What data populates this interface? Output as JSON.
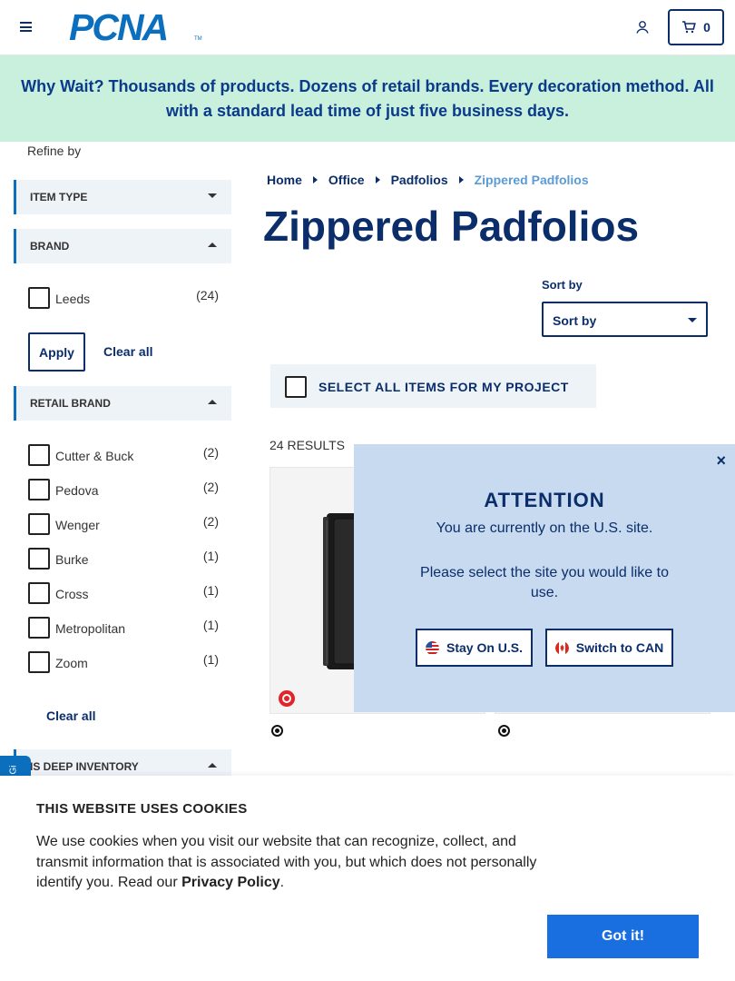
{
  "header": {
    "logo_text": "PCNA",
    "logo_tm": "TM",
    "cart_count": "0"
  },
  "banner": {
    "text": "Why Wait? Thousands of products. Dozens of retail brands. Every decoration method. All with a standard lead time of just five business days."
  },
  "sidebar": {
    "refine_by": "Refine by",
    "facets": {
      "item_type": {
        "label": "ITEM TYPE"
      },
      "brand": {
        "label": "BRAND",
        "options": [
          {
            "label": "Leeds",
            "count": "(24)"
          }
        ],
        "apply_label": "Apply",
        "clear_label": "Clear all"
      },
      "retail_brand": {
        "label": "RETAIL BRAND",
        "options": [
          {
            "label": "Cutter & Buck",
            "count": "(2)"
          },
          {
            "label": "Pedova",
            "count": "(2)"
          },
          {
            "label": "Wenger",
            "count": "(2)"
          },
          {
            "label": "Burke",
            "count": "(1)"
          },
          {
            "label": "Cross",
            "count": "(1)"
          },
          {
            "label": "Metropolitan",
            "count": "(1)"
          },
          {
            "label": "Zoom",
            "count": "(1)"
          }
        ],
        "clear_label": "Clear all"
      },
      "deep_inventory": {
        "label": "IS DEEP INVENTORY"
      }
    }
  },
  "breadcrumb": [
    {
      "label": "Home"
    },
    {
      "label": "Office"
    },
    {
      "label": "Padfolios"
    },
    {
      "label": "Zippered Padfolios"
    }
  ],
  "page_title": "Zippered Padfolios",
  "sort": {
    "label": "Sort by",
    "value": "Sort by"
  },
  "select_all_label": "SELECT ALL ITEMS FOR MY PROJECT",
  "results_count": "24 RESULTS",
  "modal": {
    "close": "×",
    "title": "ATTENTION",
    "line1": "You are currently on the U.S. site.",
    "line2": "Please select the site you would like to use.",
    "stay_label": "Stay On U.S.",
    "switch_label": "Switch to CAN"
  },
  "side_tab": {
    "label": "Gi"
  },
  "cookie": {
    "title": "THIS WEBSITE USES COOKIES",
    "text": "We use cookies when you visit our website that can recognize, collect, and transmit information that is associated with you, but which does not personally identify you. Read our",
    "link": "Privacy Policy",
    "period": ".",
    "button": "Got it!"
  },
  "colors": {
    "navy": "#0b2e6b",
    "brand_blue": "#0b6fbd",
    "banner_bg": "#c8f0dc",
    "modal_bg": "#c8daf0",
    "cookie_button": "#1a6fe0"
  }
}
